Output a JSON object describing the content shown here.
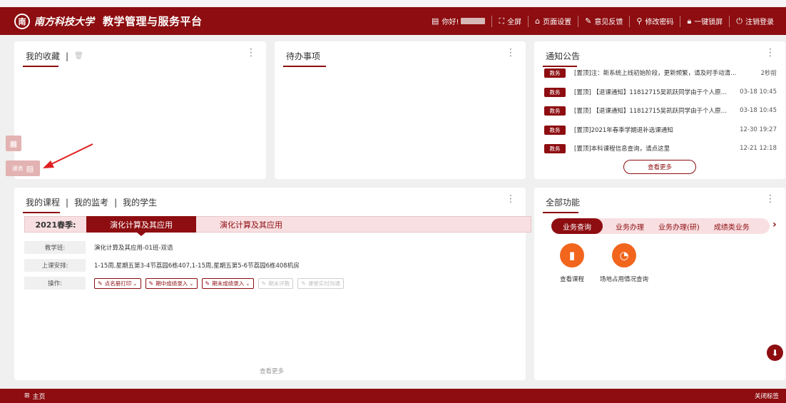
{
  "header": {
    "logo_text": "南方科技大学",
    "title": "教学管理与服务平台",
    "greeting": "你好!",
    "items": [
      "全屏",
      "页面设置",
      "意见反馈",
      "修改密码",
      "一键锁屏",
      "注销登录"
    ]
  },
  "favorites": {
    "title": "我的收藏",
    "separator": "|"
  },
  "todo": {
    "title": "待办事项"
  },
  "notices": {
    "title": "通知公告",
    "items": [
      {
        "badge": "教务",
        "text": "[置顶]注：新系统上线初始阶段，更新频繁，请及时手动清...",
        "time": "2秒前"
      },
      {
        "badge": "教务",
        "text": "[置顶] 【退课通知】11812715吴凯跃同学由于个人原因申请...",
        "time": "03-18 10:45"
      },
      {
        "badge": "教务",
        "text": "[置顶] 【退课通知】11812715吴凯跃同学由于个人原因申请...",
        "time": "03-18 10:45"
      },
      {
        "badge": "教务",
        "text": "[置顶]2021年春季学期退补选课通知",
        "time": "12-30 19:27"
      },
      {
        "badge": "教务",
        "text": "[置顶]本科课程信息查询，请点这里",
        "time": "12-21 12:18"
      }
    ],
    "more": "查看更多"
  },
  "float_tools": {
    "kb_label": "课表"
  },
  "courses": {
    "tabs": [
      "我的课程",
      "我的监考",
      "我的学生"
    ],
    "separator": "|",
    "season": "2021春季:",
    "course_tabs": [
      "演化计算及其应用",
      "演化计算及其应用"
    ],
    "rows": [
      {
        "label": "教学班:",
        "value": "演化计算及其应用-01班-双语"
      },
      {
        "label": "上课安排:",
        "value": "1-15周,星期五第3-4节荔园6栋407,1-15周,星期五第5-6节荔园6栋408机房"
      },
      {
        "label": "操作:"
      }
    ],
    "ops": [
      "点名册打印",
      "期中成绩录入",
      "期末成绩录入",
      "期末评教",
      "课堂实时沟通"
    ],
    "more": "查看更多"
  },
  "functions": {
    "title": "全部功能",
    "tabs": [
      "业务查询",
      "业务办理",
      "业务办理(研)",
      "成绩类业务"
    ],
    "items": [
      "查看课程",
      "场地占用情况查询"
    ]
  },
  "footer": {
    "home": "主页",
    "close": "关闭标签"
  }
}
